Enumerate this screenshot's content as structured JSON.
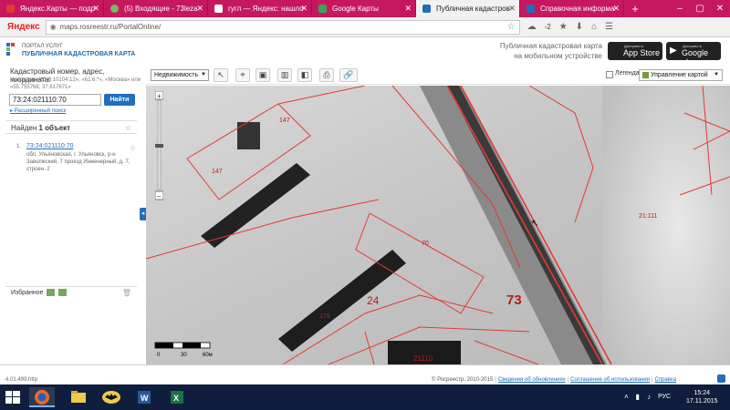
{
  "browser": {
    "tabs": [
      {
        "label": "Яндекс.Карты — подр",
        "active": false,
        "icon": "yandex-maps-favicon"
      },
      {
        "label": "(5) Входящие - 73leza",
        "active": false,
        "icon": "mail-favicon"
      },
      {
        "label": "гугл — Яндекс: нашло",
        "active": false,
        "icon": "yandex-search-favicon"
      },
      {
        "label": "Google Карты",
        "active": false,
        "icon": "google-maps-favicon"
      },
      {
        "label": "Публичная кадастров",
        "active": true,
        "icon": "rosreestr-favicon"
      },
      {
        "label": "Справочная информа",
        "active": false,
        "icon": "rosreestr-favicon"
      }
    ],
    "yandex_button": "Яндекс",
    "url_host": "maps.rosreestr.ru",
    "url_path": "/PortalOnline/",
    "weather": "-2"
  },
  "header": {
    "logo_top": "Портал услуг",
    "logo_bottom": "Публичная кадастровая карта",
    "promo_line1": "Публичная кадастровая карта",
    "promo_line2": "на мобильном устройстве",
    "appstore_small": "Доступно в",
    "appstore_big": "App Store",
    "googleplay_small": "Доступно в",
    "googleplay_big": "Google play"
  },
  "sidebar": {
    "search_title": "Кадастровый номер, адрес, координата:",
    "search_example": "Например «61:6:10104:12», «61:6:*», «Москва» или «55.755768, 37.617671»",
    "search_value": "73:24:021110:70",
    "find_label": "Найти",
    "advanced_label": "Расширенный поиск",
    "results_prefix": "Найден",
    "results_count": "1 объект",
    "result": {
      "index": "1.",
      "cadastral_number": "73:24:021110:70",
      "address": "обл. Ульяновская, г. Ульяновск, р-н Заволжский, 7 проезд Инженерный, д. 7, строен. 2"
    },
    "favorites_label": "Избранное"
  },
  "toolbar": {
    "layer_select": "Недвижимость",
    "legend_label": "Легенда",
    "map_control_label": "Управление картой"
  },
  "map": {
    "labels": [
      "147",
      "147",
      "70",
      "24",
      "179",
      "73",
      "21110",
      "21:111"
    ],
    "scale_labels": [
      "0",
      "30",
      "60м"
    ]
  },
  "status": {
    "version": "4.01.499.http",
    "copyright": "© Росреестр, 2010-2015",
    "link_updates": "Сведения об обновлениях",
    "link_terms": "Соглашение об использовании",
    "link_help": "Справка"
  },
  "taskbar": {
    "lang": "РУС",
    "time": "15:24",
    "date": "17.11.2015"
  },
  "colors": {
    "tabstrip": "#c5185f",
    "accent": "#1f6fbd",
    "parcel_border": "#e53935",
    "taskbar": "#0f1e3c"
  }
}
